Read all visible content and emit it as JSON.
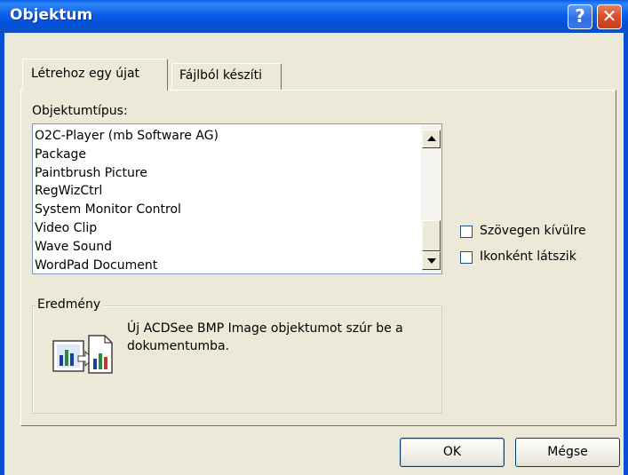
{
  "window": {
    "title": "Objektum",
    "help_glyph": "?",
    "close_glyph": "✕"
  },
  "tabs": [
    {
      "label": "Létrehoz egy újat",
      "active": true
    },
    {
      "label": "Fájlból készíti",
      "active": false
    }
  ],
  "object_type": {
    "label": "Objektumtípus:",
    "items": [
      "O2C-Player (mb Software AG)",
      "Package",
      "Paintbrush Picture",
      "RegWizCtrl",
      "System Monitor Control",
      "Video Clip",
      "Wave Sound",
      "WordPad Document"
    ]
  },
  "options": {
    "display_outside": {
      "label": "Szövegen kívülre",
      "checked": false
    },
    "show_as_icon": {
      "label": "Ikonként látszik",
      "checked": false
    }
  },
  "result": {
    "title": "Eredmény",
    "text": "Új ACDSee BMP Image objektumot szúr be a dokumentumba."
  },
  "buttons": {
    "ok": "OK",
    "cancel": "Mégse"
  },
  "colors": {
    "titlebar": "#0a5de9",
    "dialog_bg": "#ece9d8",
    "close_button": "#d54a26"
  },
  "icons": {
    "help": "help-icon",
    "close": "close-icon",
    "result": "insert-object-icon"
  }
}
